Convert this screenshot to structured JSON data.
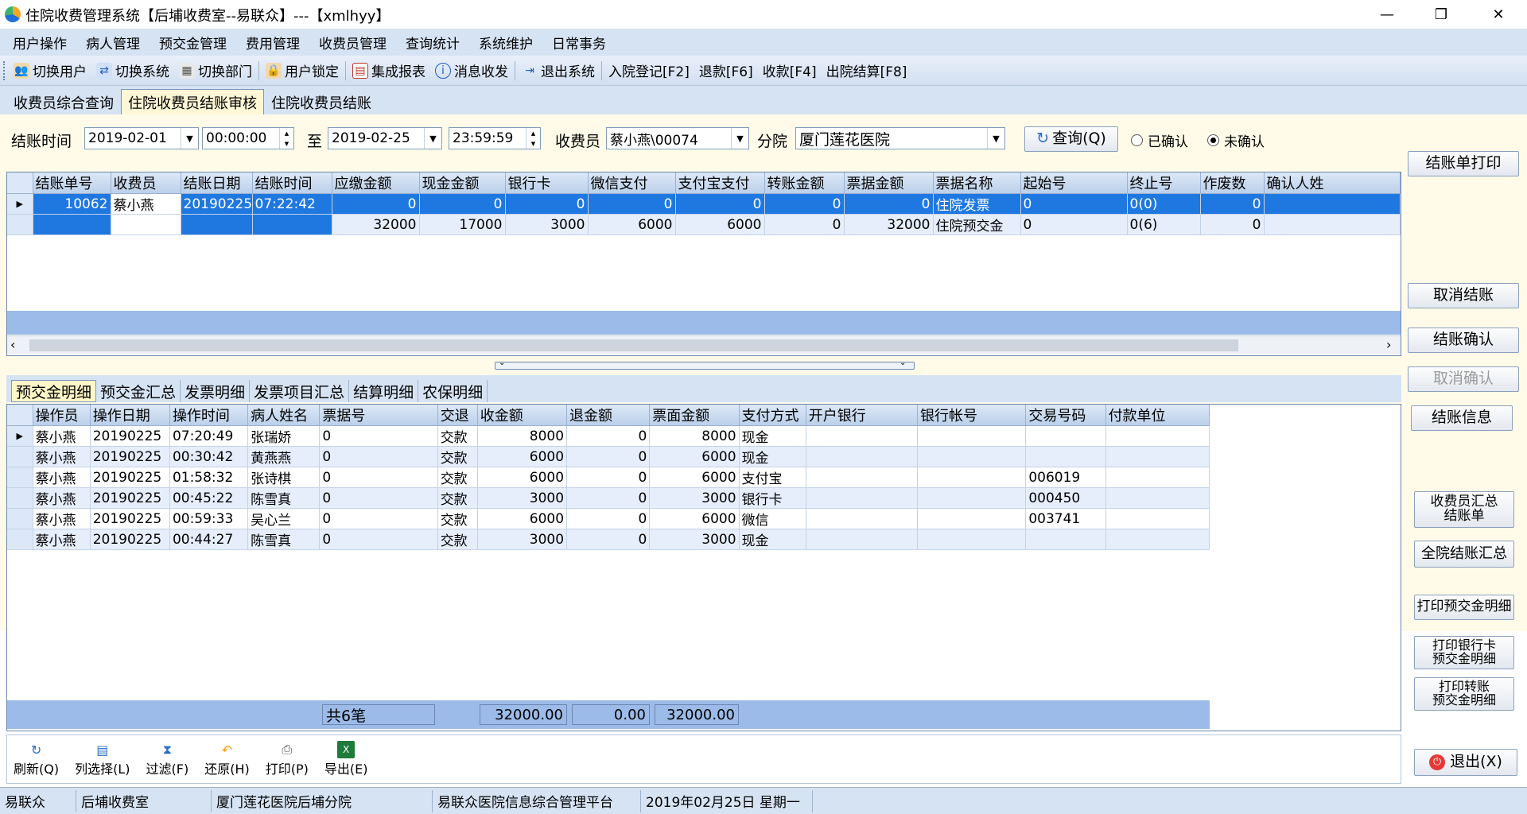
{
  "window": {
    "title": "住院收费管理系统【后埔收费室--易联众】---【xmlhyy】",
    "minimize": "—",
    "restore": "❐",
    "close": "✕"
  },
  "menu": [
    "用户操作",
    "病人管理",
    "预交金管理",
    "费用管理",
    "收费员管理",
    "查询统计",
    "系统维护",
    "日常事务"
  ],
  "toolbar": {
    "switch_user": "切换用户",
    "switch_system": "切换系统",
    "switch_dept": "切换部门",
    "user_lock": "用户锁定",
    "reports": "集成报表",
    "messages": "消息收发",
    "exit_system": "退出系统",
    "admission": "入院登记[F2]",
    "refund": "退款[F6]",
    "collect": "收款[F4]",
    "discharge": "出院结算[F8]"
  },
  "top_tabs": [
    "收费员综合查询",
    "住院收费员结账审核",
    "住院收费员结账"
  ],
  "filter": {
    "time_label": "结账时间",
    "date_from": "2019-02-01",
    "time_from": "00:00:00",
    "to_label": "至",
    "date_to": "2019-02-25",
    "time_to": "23:59:59",
    "cashier_label": "收费员",
    "cashier_value": "蔡小燕\\00074",
    "branch_label": "分院",
    "branch_value": "厦门莲花医院",
    "query_button": "查询(Q)",
    "confirmed": "已确认",
    "unconfirmed": "未确认"
  },
  "upper_grid": {
    "columns": [
      "结账单号",
      "收费员",
      "结账日期",
      "结账时间",
      "应缴金额",
      "现金金额",
      "银行卡",
      "微信支付",
      "支付宝支付",
      "转账金额",
      "票据金额",
      "票据名称",
      "起始号",
      "终止号",
      "作废数",
      "确认人姓"
    ],
    "rows": [
      [
        "10062",
        "蔡小燕",
        "20190225",
        "07:22:42",
        "0",
        "0",
        "0",
        "0",
        "0",
        "0",
        "0",
        "住院发票",
        "0",
        "0(0)",
        "0",
        ""
      ],
      [
        "",
        "",
        "",
        "",
        "32000",
        "17000",
        "3000",
        "6000",
        "6000",
        "0",
        "32000",
        "住院预交金",
        "0",
        "0(6)",
        "0",
        ""
      ]
    ]
  },
  "right_buttons": {
    "print_settle": "结账单打印",
    "cancel_settle": "取消结账",
    "confirm_settle": "结账确认",
    "cancel_confirm": "取消确认",
    "settle_info": "结账信息",
    "cashier_summary": "收费员汇总\n结账单",
    "hospital_summary": "全院结账汇总",
    "print_prepay": "打印预交金明细",
    "print_bank_prepay": "打印银行卡\n预交金明细",
    "print_transfer_prepay": "打印转账\n预交金明细",
    "exit": "退出(X)"
  },
  "bottom_tabs": [
    "预交金明细",
    "预交金汇总",
    "发票明细",
    "发票项目汇总",
    "结算明细",
    "农保明细"
  ],
  "lower_grid": {
    "columns": [
      "操作员",
      "操作日期",
      "操作时间",
      "病人姓名",
      "票据号",
      "交退",
      "收金额",
      "退金额",
      "票面金额",
      "支付方式",
      "开户银行",
      "银行帐号",
      "交易号码",
      "付款单位"
    ],
    "rows": [
      [
        "蔡小燕",
        "20190225",
        "07:20:49",
        "张瑞娇",
        "0",
        "交款",
        "8000",
        "0",
        "8000",
        "现金",
        "",
        "",
        "",
        ""
      ],
      [
        "蔡小燕",
        "20190225",
        "00:30:42",
        "黄燕燕",
        "0",
        "交款",
        "6000",
        "0",
        "6000",
        "现金",
        "",
        "",
        "",
        ""
      ],
      [
        "蔡小燕",
        "20190225",
        "01:58:32",
        "张诗棋",
        "0",
        "交款",
        "6000",
        "0",
        "6000",
        "支付宝",
        "",
        "",
        "006019",
        ""
      ],
      [
        "蔡小燕",
        "20190225",
        "00:45:22",
        "陈雪真",
        "0",
        "交款",
        "3000",
        "0",
        "3000",
        "银行卡",
        "",
        "",
        "000450",
        ""
      ],
      [
        "蔡小燕",
        "20190225",
        "00:59:33",
        "吴心兰",
        "0",
        "交款",
        "6000",
        "0",
        "6000",
        "微信",
        "",
        "",
        "003741",
        ""
      ],
      [
        "蔡小燕",
        "20190225",
        "00:44:27",
        "陈雪真",
        "0",
        "交款",
        "3000",
        "0",
        "3000",
        "现金",
        "",
        "",
        "",
        ""
      ]
    ],
    "footer": {
      "count": "共6笔",
      "collected": "32000.00",
      "refunded": "0.00",
      "face": "32000.00"
    }
  },
  "bottom_toolbar": {
    "refresh": "刷新(Q)",
    "columns": "列选择(L)",
    "filter": "过滤(F)",
    "restore": "还原(H)",
    "print": "打印(P)",
    "export": "导出(E)"
  },
  "status": [
    "易联众",
    "后埔收费室",
    "厦门莲花医院后埔分院",
    "易联众医院信息综合管理平台",
    "2019年02月25日 星期一"
  ]
}
